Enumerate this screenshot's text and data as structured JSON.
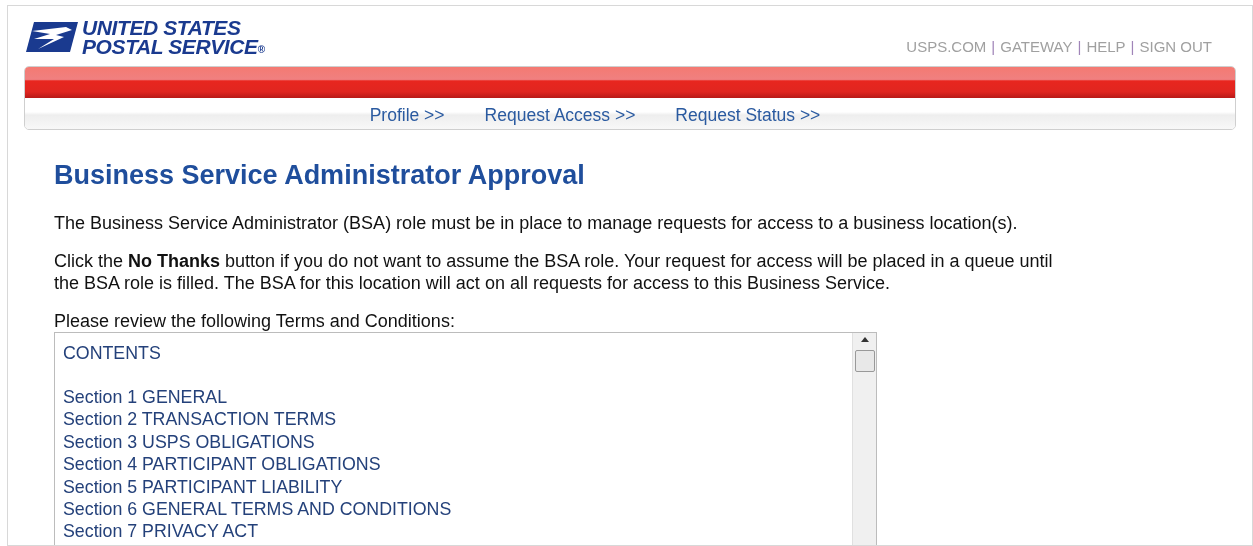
{
  "logo": {
    "line_1": "UNITED STATES",
    "line_2": "POSTAL SERVICE",
    "mark": "®"
  },
  "header_links": [
    {
      "label": "USPS.COM"
    },
    {
      "label": "GATEWAY"
    },
    {
      "label": "HELP"
    },
    {
      "label": "SIGN OUT"
    }
  ],
  "link_separator": "|",
  "nav": [
    {
      "label": "Profile >>"
    },
    {
      "label": "Request Access >>"
    },
    {
      "label": "Request Status >>"
    }
  ],
  "heading": "Business Service Administrator Approval",
  "paragraphs": [
    "The Business Service Administrator (BSA) role must be in place to manage requests for access to a business location(s).",
    "Click the **No Thanks** button if you do not want to assume the BSA role. Your request for access will be placed in a queue until the BSA role is filled. The BSA for this location will act on all requests for access to this Business Service."
  ],
  "terms": {
    "label": "Please review the following Terms and Conditions:",
    "lines": [
      {
        "text": "CONTENTS",
        "kind": "title"
      },
      {
        "text": "Section 1 GENERAL",
        "kind": "item"
      },
      {
        "text": "Section 2 TRANSACTION TERMS",
        "kind": "item"
      },
      {
        "text": "Section 3 USPS OBLIGATIONS",
        "kind": "item"
      },
      {
        "text": "Section 4 PARTICIPANT OBLIGATIONS",
        "kind": "item"
      },
      {
        "text": "Section 5 PARTICIPANT LIABILITY",
        "kind": "item"
      },
      {
        "text": "Section 6 GENERAL TERMS AND CONDITIONS",
        "kind": "item"
      },
      {
        "text": "Section 7 PRIVACY ACT",
        "kind": "item"
      }
    ]
  }
}
